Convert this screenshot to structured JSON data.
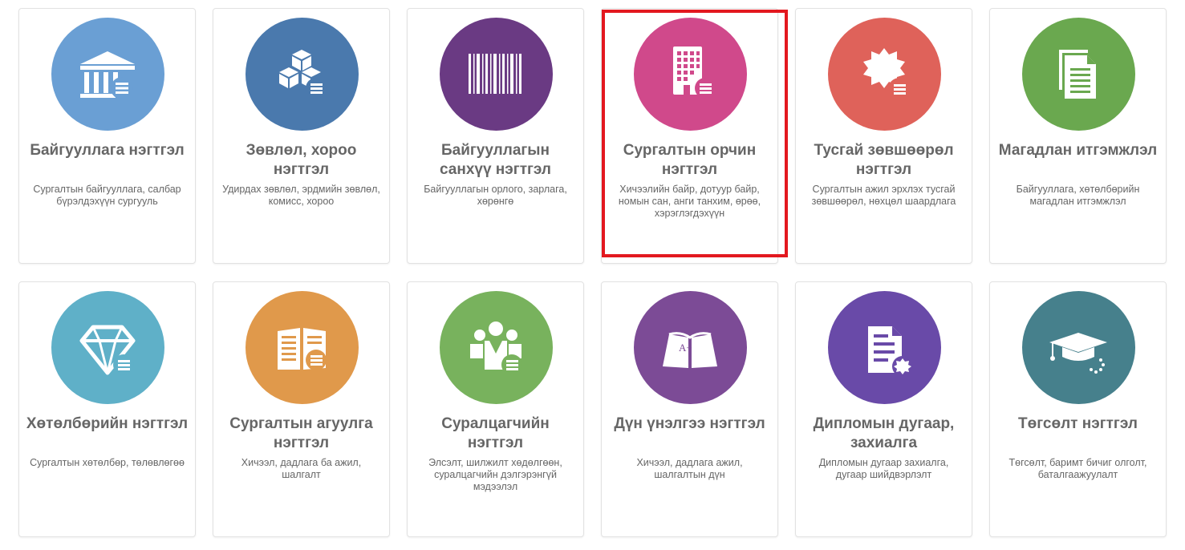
{
  "cards": [
    {
      "title": "Байгууллага нэгтгэл",
      "desc": "Сургалтын байгууллага, салбар бүрэлдэхүүн сургууль",
      "color": "#6a9fd4",
      "icon": "institution-icon"
    },
    {
      "title": "Зөвлөл, хороо нэгтгэл",
      "desc": "Удирдах зөвлөл, эрдмийн зөвлөл, комисс, хороо",
      "color": "#4a79ad",
      "icon": "cubes-icon"
    },
    {
      "title": "Байгууллагын санхүү нэгтгэл",
      "desc": "Байгууллагын орлого, зарлага, хөрөнгө",
      "color": "#6a3a83",
      "icon": "barcode-icon"
    },
    {
      "title": "Сургалтын орчин нэгтгэл",
      "desc": "Хичээлийн байр, дотуур байр, номын сан, анги танхим, өрөө, хэрэглэгдэхүүн",
      "color": "#d0498b",
      "icon": "building-icon"
    },
    {
      "title": "Тусгай зөвшөөрөл нэгтгэл",
      "desc": "Сургалтын ажил эрхлэх тусгай зөвшөөрөл, нөхцөл шаардлага",
      "color": "#df625a",
      "icon": "certificate-icon"
    },
    {
      "title": "Магадлан итгэмжлэл",
      "desc": "Байгууллага, хөтөлбөрийн магадлан итгэмжлэл",
      "color": "#6aa84f",
      "icon": "documents-icon"
    },
    {
      "title": "Хөтөлбөрийн нэгтгэл",
      "desc": "Сургалтын хөтөлбөр, төлөвлөгөө",
      "color": "#5fb0c8",
      "icon": "diamond-icon"
    },
    {
      "title": "Сургалтын агуулга нэгтгэл",
      "desc": "Хичээл, дадлага ба ажил, шалгалт",
      "color": "#e0994b",
      "icon": "book-icon"
    },
    {
      "title": "Суралцагчийн нэгтгэл",
      "desc": "Элсэлт, шилжилт хөдөлгөөн, суралцагчийн дэлгэрэнгүй мэдээлэл",
      "color": "#78b25d",
      "icon": "students-icon"
    },
    {
      "title": "Дүн үнэлгээ нэгтгэл",
      "desc": "Хичээл, дадлага ажил, шалгалтын дүн",
      "color": "#7c4b96",
      "icon": "grade-book-icon"
    },
    {
      "title": "Дипломын дугаар, захиалга",
      "desc": "Дипломын дугаар захиалга, дугаар шийдвэрлэлт",
      "color": "#694aa8",
      "icon": "diploma-file-icon"
    },
    {
      "title": "Төгсөлт нэгтгэл",
      "desc": "Төгсөлт, баримт бичиг олголт, баталгаажуулалт",
      "color": "#46808c",
      "icon": "graduation-cap-icon"
    }
  ],
  "selected_index": 3
}
